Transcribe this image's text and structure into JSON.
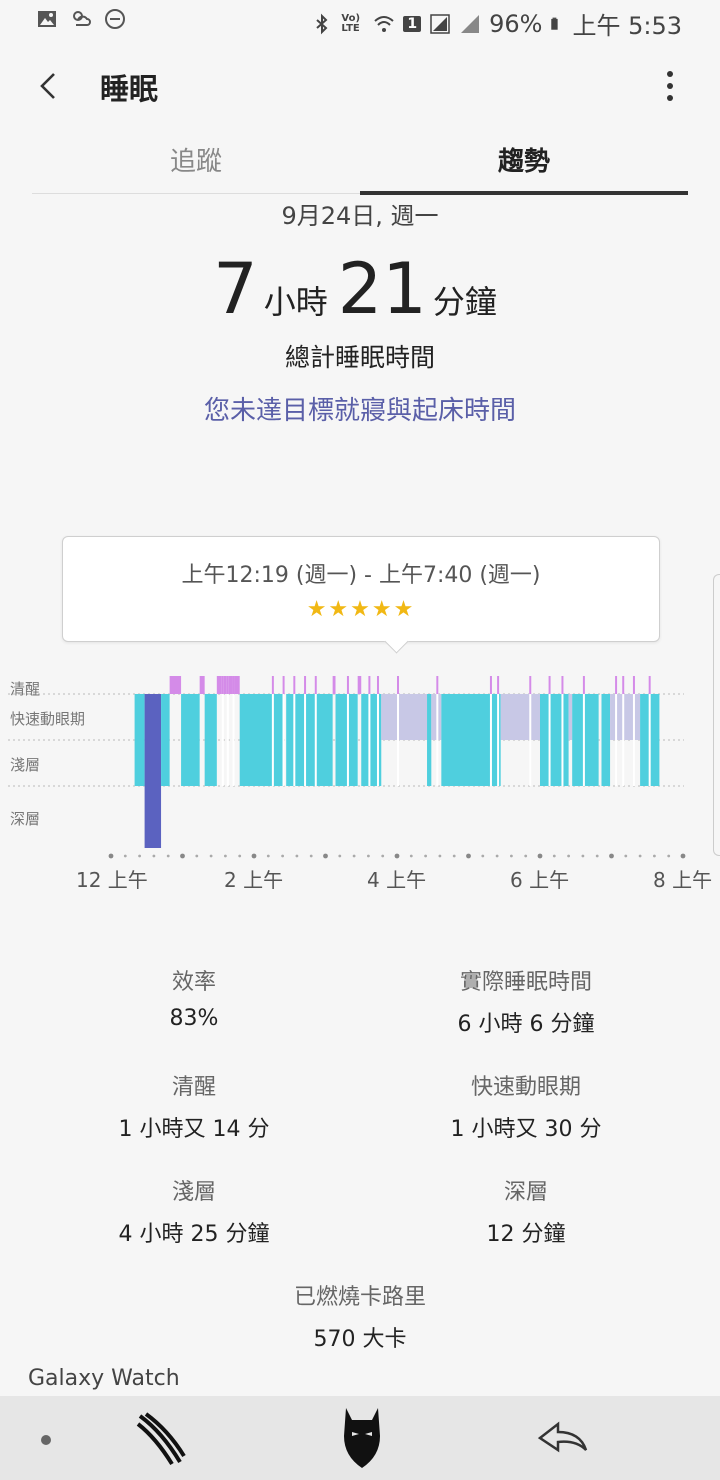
{
  "status_bar": {
    "battery": "96%",
    "time": "上午 5:53",
    "sim": "1",
    "lte": "Vo) LTE"
  },
  "app_bar": {
    "title": "睡眠"
  },
  "tabs": [
    {
      "label": "追蹤",
      "active": false
    },
    {
      "label": "趨勢",
      "active": true
    }
  ],
  "summary": {
    "date": "9月24日, 週一",
    "hours": "7",
    "hours_unit": "小時",
    "minutes": "21",
    "minutes_unit": "分鐘",
    "total_label": "總計睡眠時間",
    "goal_message": "您未達目標就寢與起床時間"
  },
  "tooltip": {
    "range": "上午12:19 (週一) - 上午7:40 (週一)",
    "stars": "★★★★★"
  },
  "chart_data": {
    "type": "bar",
    "stages": [
      "清醒",
      "快速動眼期",
      "淺層",
      "深層"
    ],
    "x_ticks": [
      "12 上午",
      "2 上午",
      "4 上午",
      "6 上午",
      "8 上午"
    ],
    "x_range_hours": [
      0,
      8
    ],
    "colors": {
      "awake": "#d48be8",
      "rem": "#c8c8e6",
      "light": "#4fcfde",
      "deep": "#5b62c0"
    },
    "segments": [
      {
        "stage": "淺層",
        "start": 0.33,
        "end": 0.47
      },
      {
        "stage": "深層",
        "start": 0.47,
        "end": 0.7
      },
      {
        "stage": "淺層",
        "start": 0.7,
        "end": 0.82
      },
      {
        "stage": "清醒",
        "start": 0.82,
        "end": 0.98
      },
      {
        "stage": "淺層",
        "start": 0.98,
        "end": 1.24
      },
      {
        "stage": "清醒",
        "start": 1.24,
        "end": 1.31
      },
      {
        "stage": "淺層",
        "start": 1.31,
        "end": 1.48
      },
      {
        "stage": "清醒",
        "start": 1.48,
        "end": 1.8
      },
      {
        "stage": "淺層",
        "start": 1.8,
        "end": 2.4
      },
      {
        "stage": "淺層",
        "start": 2.45,
        "end": 3.1
      },
      {
        "stage": "清醒",
        "start": 3.1,
        "end": 3.14
      },
      {
        "stage": "淺層",
        "start": 3.14,
        "end": 3.45
      },
      {
        "stage": "清醒",
        "start": 3.45,
        "end": 3.5
      },
      {
        "stage": "淺層",
        "start": 3.5,
        "end": 3.78
      },
      {
        "stage": "快速動眼期",
        "start": 3.78,
        "end": 4.42
      },
      {
        "stage": "淺層",
        "start": 4.42,
        "end": 4.48
      },
      {
        "stage": "快速動眼期",
        "start": 4.48,
        "end": 4.62
      },
      {
        "stage": "淺層",
        "start": 4.62,
        "end": 5.45
      },
      {
        "stage": "快速動眼期",
        "start": 5.45,
        "end": 6.0
      },
      {
        "stage": "淺層",
        "start": 6.0,
        "end": 6.4
      },
      {
        "stage": "快速動眼期",
        "start": 6.4,
        "end": 6.45
      },
      {
        "stage": "淺層",
        "start": 6.45,
        "end": 6.82
      },
      {
        "stage": "淺層",
        "start": 6.86,
        "end": 6.98
      },
      {
        "stage": "快速動眼期",
        "start": 6.98,
        "end": 7.4
      },
      {
        "stage": "淺層",
        "start": 7.4,
        "end": 7.67
      }
    ],
    "awake_blips": [
      1.55,
      1.62,
      1.7,
      2.25,
      2.4,
      2.55,
      2.7,
      2.85,
      3.3,
      3.6,
      3.72,
      4.0,
      4.55,
      5.3,
      5.4,
      5.85,
      6.12,
      6.3,
      6.6,
      7.05,
      7.15,
      7.3,
      7.52
    ]
  },
  "stats": [
    {
      "label": "效率",
      "value": "83%"
    },
    {
      "label": "實際睡眠時間",
      "value": "6 小時 6 分鐘"
    },
    {
      "label": "清醒",
      "value": "1 小時又 14 分"
    },
    {
      "label": "快速動眼期",
      "value": "1 小時又 30 分"
    },
    {
      "label": "淺層",
      "value": "4 小時 25 分鐘"
    },
    {
      "label": "深層",
      "value": "12 分鐘"
    },
    {
      "label": "已燃燒卡路里",
      "value": "570 大卡"
    }
  ],
  "source": "Galaxy Watch"
}
